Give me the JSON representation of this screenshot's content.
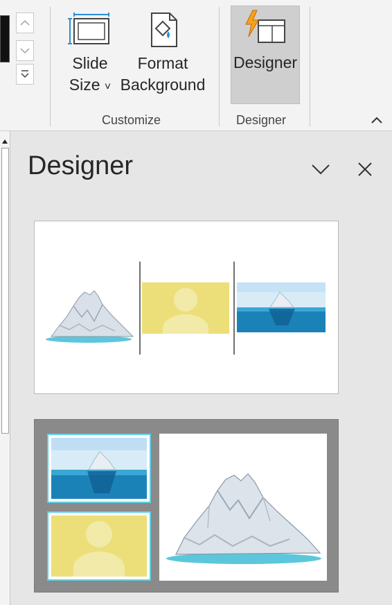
{
  "ribbon": {
    "buttons": {
      "slide_size_line1": "Slide",
      "slide_size_line2": "Size",
      "slide_size_caret": "˅",
      "format_background_line1": "Format",
      "format_background_line2": "Background",
      "designer": "Designer"
    },
    "groups": {
      "customize": "Customize",
      "designer": "Designer"
    },
    "icons": {
      "gallery_up": "chevron-up-icon",
      "gallery_down": "chevron-down-icon",
      "gallery_more": "more-icon",
      "collapse": "chevron-up-icon"
    }
  },
  "pane": {
    "title": "Designer",
    "options_icon": "chevron-down-icon",
    "close_icon": "close-icon"
  },
  "colors": {
    "designer_active_bg": "#cfcfcf",
    "placeholder_yellow": "#ecdf7a",
    "frame_accent": "#5fd0e6",
    "idea2_bg": "#8a8a8a"
  }
}
